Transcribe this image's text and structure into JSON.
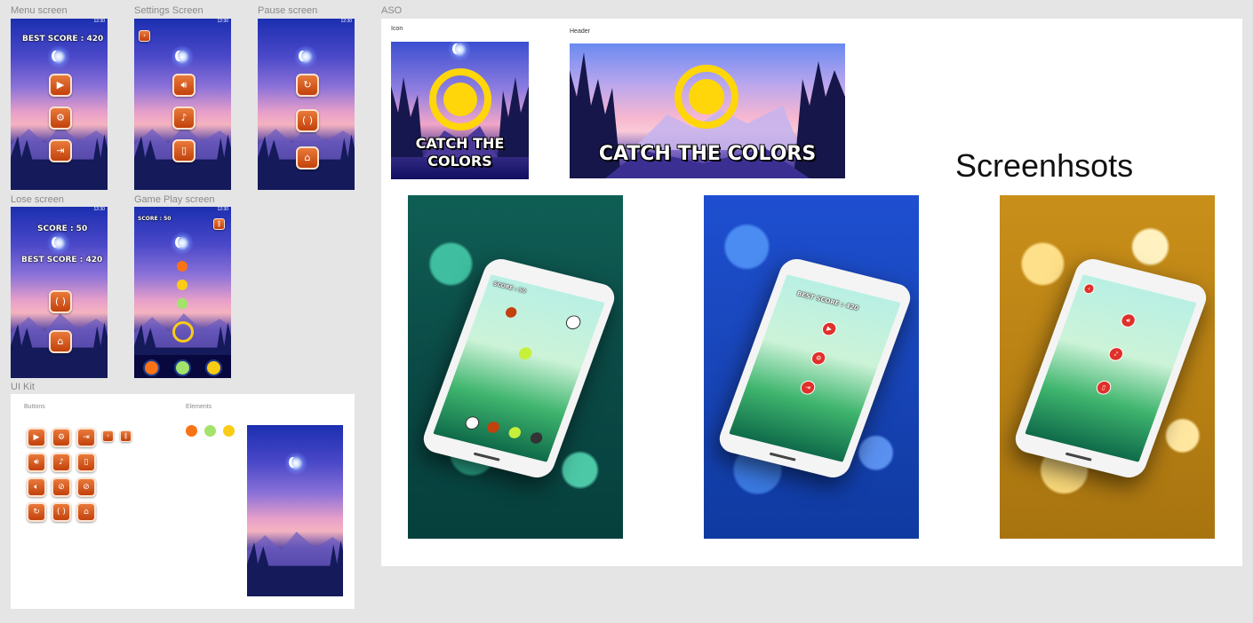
{
  "frames": {
    "menu_label": "Menu screen",
    "settings_label": "Settings Screen",
    "pause_label": "Pause screen",
    "lose_label": "Lose screen",
    "gameplay_label": "Game Play screen",
    "uikit_label": "UI Kit",
    "aso_label": "ASO"
  },
  "status_time": "12:30",
  "menu": {
    "best_score": "BEST SCORE : 420"
  },
  "lose": {
    "score": "SCORE : 50",
    "best_score": "BEST SCORE : 420"
  },
  "gameplay": {
    "score": "SCORE : 50"
  },
  "uikit": {
    "buttons_label": "Buttons",
    "elements_label": "Elements"
  },
  "elements_colors": [
    "#f97316",
    "#a3e36a",
    "#facc15"
  ],
  "aso": {
    "icon_label": "Icon",
    "header_label": "Header",
    "icon_title": "CATCH THE COLORS",
    "header_title": "CATCH THE COLORS",
    "screenshots_title": "Screenhsots"
  },
  "mockups": {
    "green_score": "SCORE : 50",
    "blue_best_score": "BEST SCORE : 420"
  },
  "icons": [
    "play-icon",
    "gear-icon",
    "exit-icon",
    "back-icon",
    "pause-icon",
    "sound-icon",
    "music-icon",
    "vibrate-icon",
    "mute-icon",
    "music-off-icon",
    "vibrate-off-icon",
    "restart-icon",
    "resume-icon",
    "home-icon"
  ]
}
